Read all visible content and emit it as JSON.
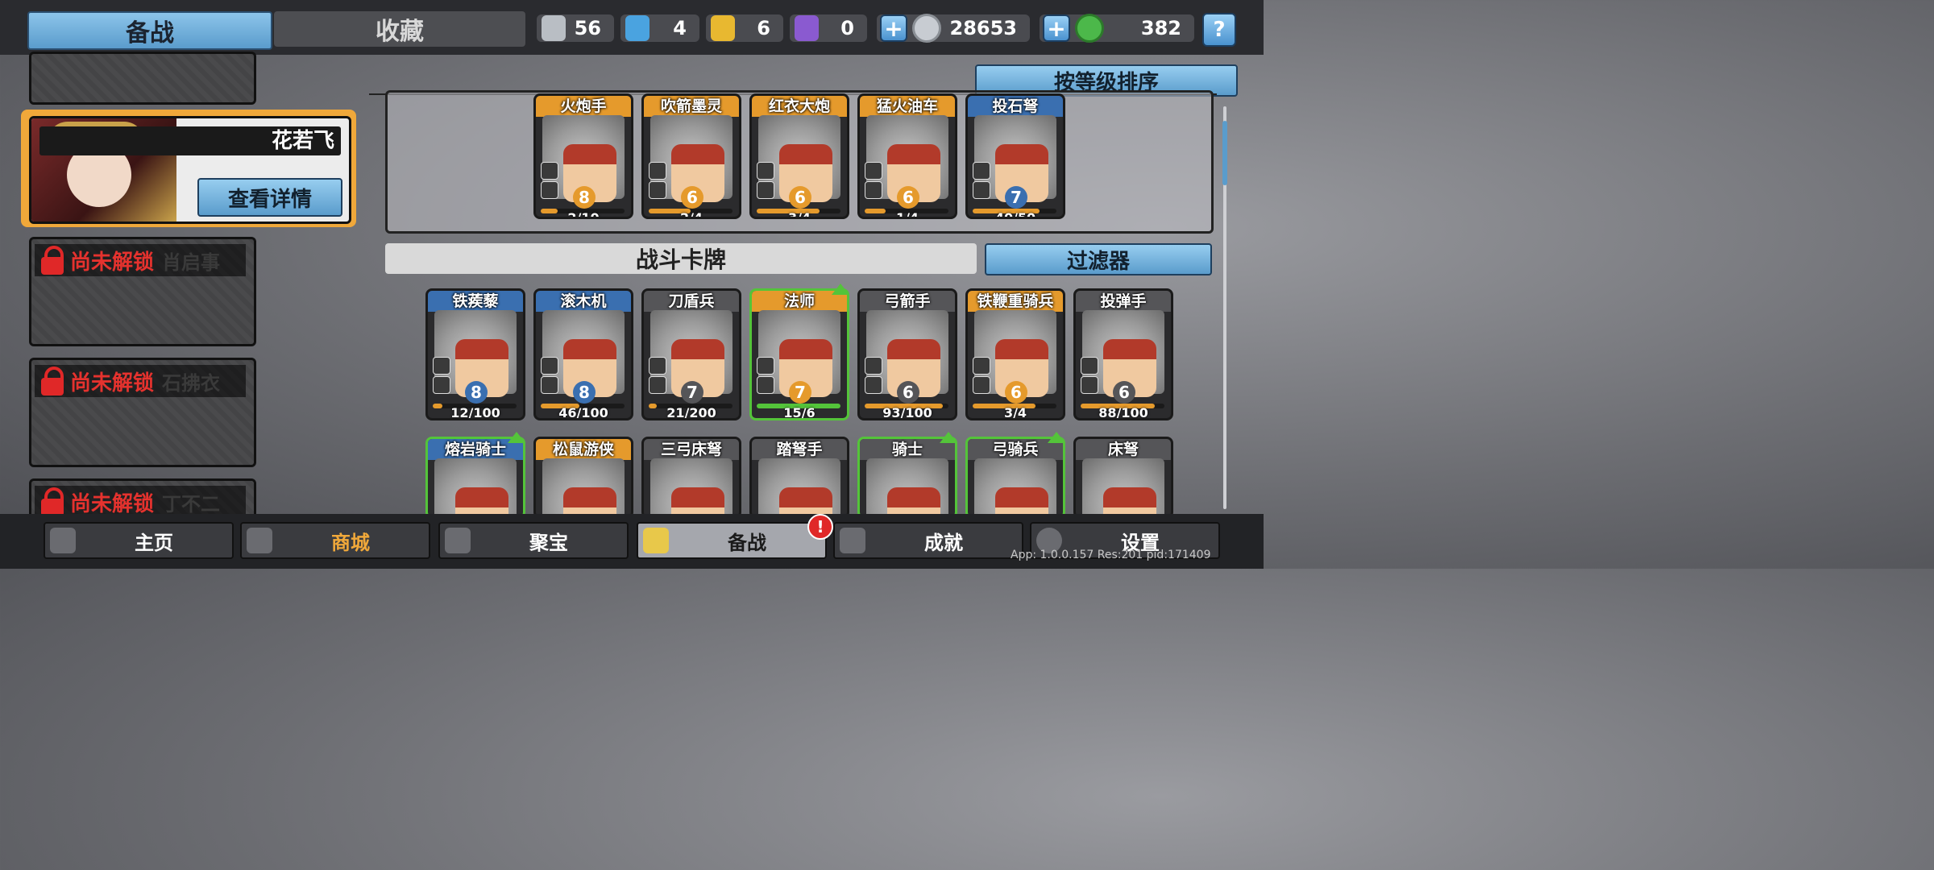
{
  "top_tabs": {
    "active": "备战",
    "inactive": "收藏"
  },
  "resources": [
    {
      "icon": "silver-shield-icon",
      "value": "56",
      "color": "#b9bec4"
    },
    {
      "icon": "blue-crystal-icon",
      "value": "4",
      "color": "#4aa3e0"
    },
    {
      "icon": "gold-shield-icon",
      "value": "6",
      "color": "#e8b830"
    },
    {
      "icon": "purple-gem-icon",
      "value": "0",
      "color": "#8a5ad0"
    }
  ],
  "currency": {
    "silver_coins": "28653",
    "jade": "382",
    "add_label": "+",
    "help_label": "?"
  },
  "hero": {
    "name": "花若飞",
    "details_button": "查看详情"
  },
  "locked_heroes": [
    {
      "status": "尚未解锁",
      "name": "肖启事"
    },
    {
      "status": "尚未解锁",
      "name": "石拂衣"
    },
    {
      "status": "尚未解锁",
      "name": "丁不二"
    }
  ],
  "sort_button": "按等级排序",
  "deck_cards": [
    {
      "name": "火炮手",
      "level": "8",
      "count": "2/10",
      "progress": 0.2,
      "rarity_color": "#e59a2c",
      "level_color": "#e59a2c"
    },
    {
      "name": "吹箭墨灵",
      "level": "6",
      "count": "2/4",
      "progress": 0.5,
      "rarity_color": "#e59a2c",
      "level_color": "#e59a2c"
    },
    {
      "name": "红衣大炮",
      "level": "6",
      "count": "3/4",
      "progress": 0.75,
      "rarity_color": "#e59a2c",
      "level_color": "#e59a2c"
    },
    {
      "name": "猛火油车",
      "level": "6",
      "count": "1/4",
      "progress": 0.25,
      "rarity_color": "#e59a2c",
      "level_color": "#e59a2c"
    },
    {
      "name": "投石弩",
      "level": "7",
      "count": "40/50",
      "progress": 0.8,
      "rarity_color": "#3a6fb0",
      "level_color": "#3a6fb0"
    }
  ],
  "battle_cards_title": "战斗卡牌",
  "filter_button": "过滤器",
  "battle_cards_row1": [
    {
      "name": "铁蒺藜",
      "level": "8",
      "count": "12/100",
      "progress": 0.12,
      "rarity_color": "#3a6fb0",
      "level_color": "#3a6fb0",
      "upgrade": false
    },
    {
      "name": "滚木机",
      "level": "8",
      "count": "46/100",
      "progress": 0.46,
      "rarity_color": "#3a6fb0",
      "level_color": "#3a6fb0",
      "upgrade": false
    },
    {
      "name": "刀盾兵",
      "level": "7",
      "count": "21/200",
      "progress": 0.1,
      "rarity_color": "#555558",
      "level_color": "#555558",
      "upgrade": false
    },
    {
      "name": "法师",
      "level": "7",
      "count": "15/6",
      "progress": 1.0,
      "rarity_color": "#e59a2c",
      "level_color": "#e59a2c",
      "upgrade": true
    },
    {
      "name": "弓箭手",
      "level": "6",
      "count": "93/100",
      "progress": 0.93,
      "rarity_color": "#555558",
      "level_color": "#555558",
      "upgrade": false
    },
    {
      "name": "铁鞭重骑兵",
      "level": "6",
      "count": "3/4",
      "progress": 0.75,
      "rarity_color": "#e59a2c",
      "level_color": "#e59a2c",
      "upgrade": false
    },
    {
      "name": "投弹手",
      "level": "6",
      "count": "88/100",
      "progress": 0.88,
      "rarity_color": "#555558",
      "level_color": "#555558",
      "upgrade": false
    }
  ],
  "battle_cards_row2": [
    {
      "name": "熔岩骑士",
      "rarity_color": "#3a6fb0",
      "upgrade": true
    },
    {
      "name": "松鼠游侠",
      "rarity_color": "#e59a2c",
      "upgrade": false
    },
    {
      "name": "三弓床弩",
      "rarity_color": "#555558",
      "upgrade": false
    },
    {
      "name": "踏弩手",
      "rarity_color": "#555558",
      "upgrade": false
    },
    {
      "name": "骑士",
      "rarity_color": "#555558",
      "upgrade": true
    },
    {
      "name": "弓骑兵",
      "rarity_color": "#555558",
      "upgrade": true
    },
    {
      "name": "床弩",
      "rarity_color": "#555558",
      "upgrade": false
    }
  ],
  "nav": [
    {
      "label": "主页",
      "icon": "home-icon",
      "active": false
    },
    {
      "label": "商城",
      "icon": "shop-coins-icon",
      "active": false,
      "highlight": true
    },
    {
      "label": "聚宝",
      "icon": "treasure-bowl-icon",
      "active": false
    },
    {
      "label": "备战",
      "icon": "cards-icon",
      "active": true,
      "badge": "!"
    },
    {
      "label": "成就",
      "icon": "achievement-icon",
      "active": false
    },
    {
      "label": "设置",
      "icon": "gear-icon",
      "active": false
    }
  ],
  "version_text": "App: 1.0.0.157 Res:201 pid:171409"
}
